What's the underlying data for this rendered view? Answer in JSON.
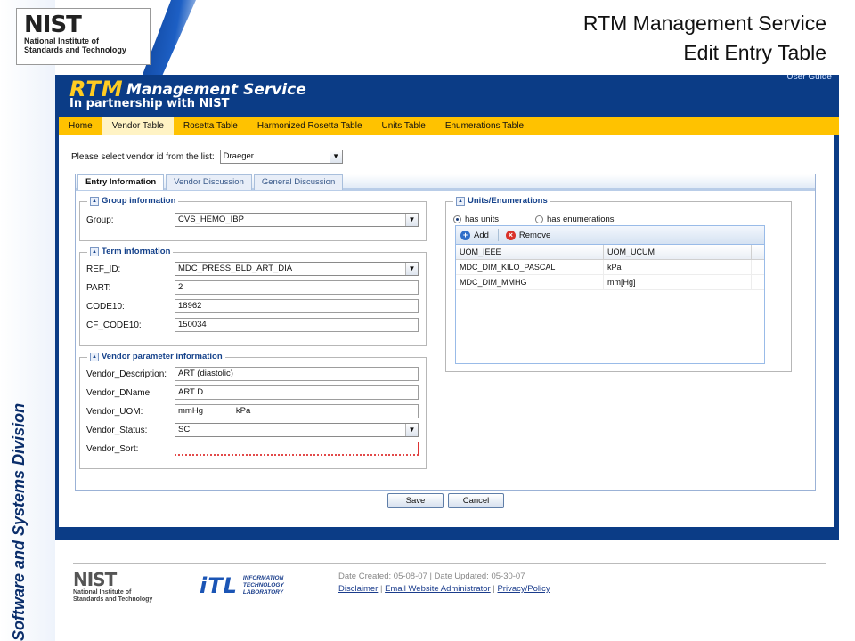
{
  "slide": {
    "title_line1": "RTM Management Service",
    "title_line2": "Edit Entry Table",
    "side_label": "Software and Systems Division",
    "logo_word": "NIST",
    "logo_sub1": "National Institute of",
    "logo_sub2": "Standards and Technology"
  },
  "banner": {
    "rtm": "RTM",
    "management_service": "Management Service",
    "partner": "In partnership with NIST",
    "user_guide": "User Guide"
  },
  "nav": {
    "items": [
      "Home",
      "Vendor Table",
      "Rosetta Table",
      "Harmonized Rosetta Table",
      "Units Table",
      "Enumerations Table"
    ],
    "active": "Vendor Table"
  },
  "vendor_select": {
    "label": "Please select vendor id from the list:",
    "value": "Draeger"
  },
  "tabs": [
    "Entry Information",
    "Vendor Discussion",
    "General Discussion"
  ],
  "group_info": {
    "legend": "Group information",
    "group_label": "Group:",
    "group_value": "CVS_HEMO_IBP"
  },
  "term_info": {
    "legend": "Term information",
    "ref_id_label": "REF_ID:",
    "ref_id_value": "MDC_PRESS_BLD_ART_DIA",
    "part_label": "PART:",
    "part_value": "2",
    "code10_label": "CODE10:",
    "code10_value": "18962",
    "cf_code10_label": "CF_CODE10:",
    "cf_code10_value": "150034"
  },
  "vendor_param": {
    "legend": "Vendor parameter information",
    "description_label": "Vendor_Description:",
    "description_value": "ART (diastolic)",
    "dname_label": "Vendor_DName:",
    "dname_value": "ART D",
    "uom_label": "Vendor_UOM:",
    "uom_value": "mmHg              kPa",
    "status_label": "Vendor_Status:",
    "status_value": "SC",
    "sort_label": "Vendor_Sort:",
    "sort_value": ""
  },
  "units": {
    "legend": "Units/Enumerations",
    "radio_units": "has units",
    "radio_enums": "has enumerations",
    "selected": "has units",
    "add_label": "Add",
    "remove_label": "Remove",
    "columns": [
      "UOM_IEEE",
      "UOM_UCUM"
    ],
    "rows": [
      [
        "MDC_DIM_KILO_PASCAL",
        "kPa"
      ],
      [
        "MDC_DIM_MMHG",
        "mm[Hg]"
      ]
    ]
  },
  "actions": {
    "save": "Save",
    "cancel": "Cancel"
  },
  "footer": {
    "nist_word": "NIST",
    "nist_sub1": "National Institute of",
    "nist_sub2": "Standards and Technology",
    "itl_mark": "iTL",
    "itl_line1": "INFORMATION",
    "itl_line2": "TECHNOLOGY",
    "itl_line3": "LABORATORY",
    "meta": "Date Created: 05-08-07 | Date Updated: 05-30-07",
    "link_disclaimer": "Disclaimer",
    "link_email": "Email Website Administrator",
    "link_privacy": "Privacy/Policy",
    "sep": "|"
  }
}
